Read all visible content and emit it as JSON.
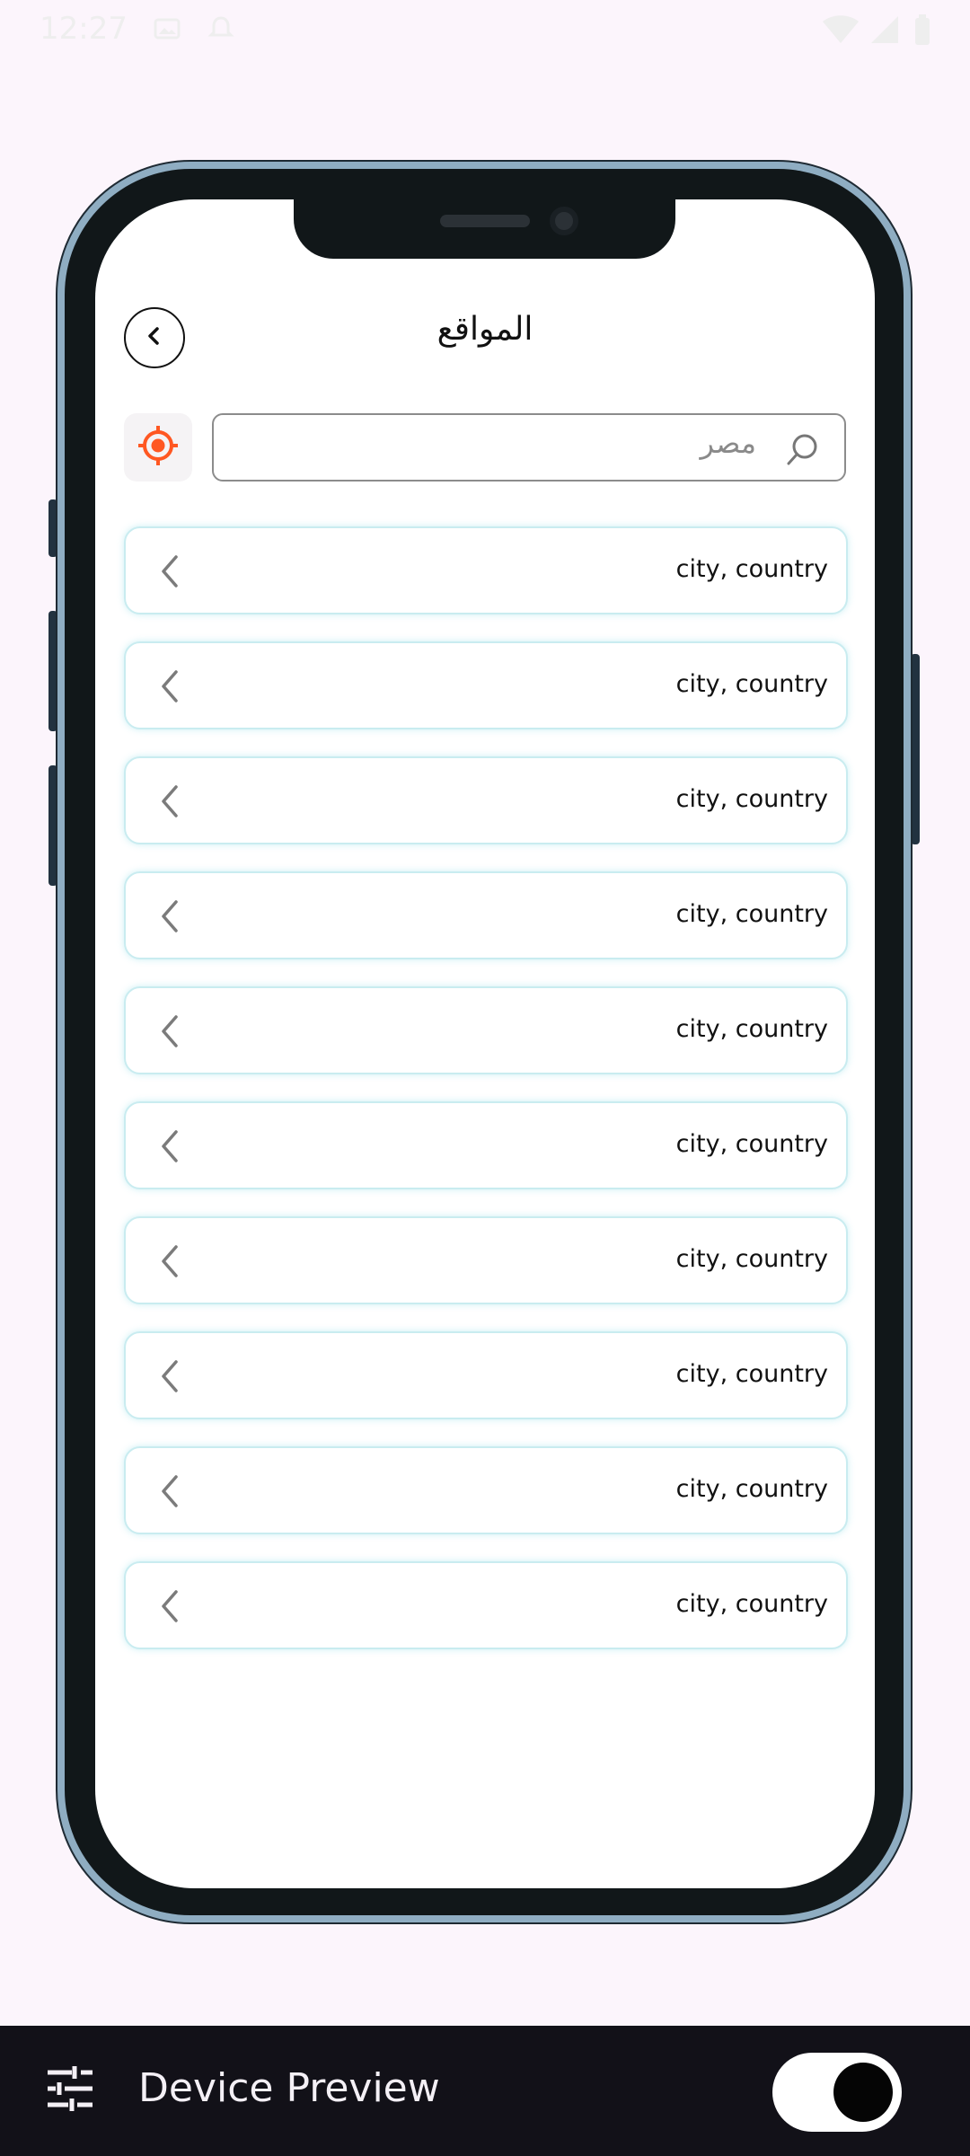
{
  "status_bar": {
    "time": "12:27"
  },
  "header": {
    "title": "المواقع",
    "back_icon": "chevron-left-icon"
  },
  "search": {
    "value": "مصر",
    "icon": "search-icon",
    "location_icon": "target-location-icon",
    "accent_color": "#ff5722"
  },
  "locations": [
    {
      "label": "city, country"
    },
    {
      "label": "city, country"
    },
    {
      "label": "city, country"
    },
    {
      "label": "city, country"
    },
    {
      "label": "city, country"
    },
    {
      "label": "city, country"
    },
    {
      "label": "city, country"
    },
    {
      "label": "city, country"
    },
    {
      "label": "city, country"
    },
    {
      "label": "city, country"
    }
  ],
  "device_preview": {
    "label": "Device Preview",
    "toggle_on": true
  }
}
